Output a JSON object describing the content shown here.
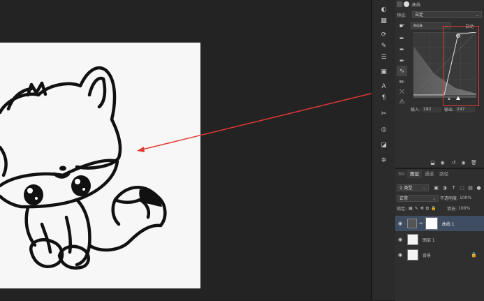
{
  "properties": {
    "tab_label": "曲线",
    "preset_label": "预设:",
    "preset_value": "自定",
    "channel_value": "RGB",
    "auto_label": "自动",
    "input_label": "输入:",
    "input_value": "182",
    "output_label": "输出:",
    "output_value": "247"
  },
  "layers_panel": {
    "tabs": [
      "3D",
      "图层",
      "通道",
      "路径"
    ],
    "active_tab": "图层",
    "filter_value": "类型",
    "blend_mode": "正常",
    "opacity_label": "不透明度:",
    "opacity_value": "100%",
    "lock_label": "锁定:",
    "fill_label": "填充:",
    "fill_value": "100%",
    "layers": [
      {
        "name": "曲线 1",
        "selected": true
      },
      {
        "name": "图层 1",
        "selected": false
      },
      {
        "name": "背景",
        "selected": false
      }
    ]
  },
  "colors": {
    "highlight_red": "#e53935",
    "panel_bg": "#2f2f2f",
    "canvas_bg": "#232323",
    "selected_layer": "#3f4d62"
  }
}
